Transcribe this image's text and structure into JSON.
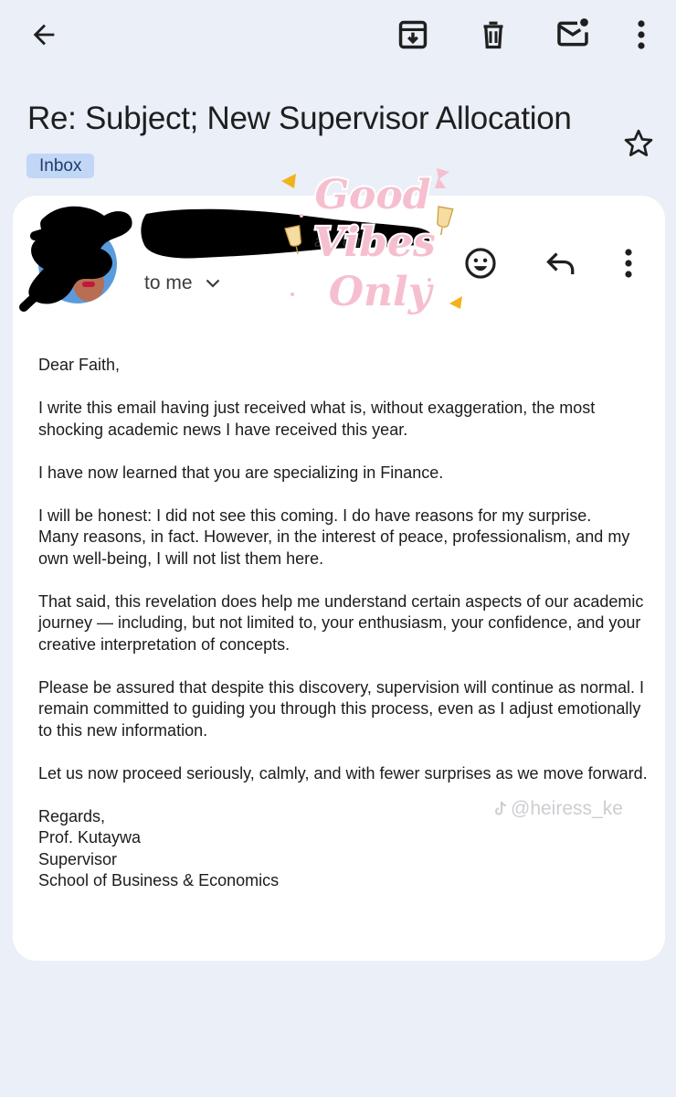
{
  "toolbar": {
    "icons": [
      "back-arrow-icon",
      "archive-icon",
      "trash-icon",
      "mark-unread-icon",
      "more-vert-icon"
    ]
  },
  "email": {
    "subject": "Re: Subject; New Supervisor Allocation",
    "label": "Inbox",
    "recipient": "to me",
    "sender_partial": "a: · em",
    "body": {
      "greeting": "Dear Faith,",
      "p1": "I write this email having just received what is, without exaggeration, the most shocking academic news I have received this year.",
      "p2": "I have now learned that you are specializing in Finance.",
      "p3_line1": "I will be honest: I did not see this coming. I do have reasons for my surprise.",
      "p3_line2": "Many reasons, in fact. However, in the interest of peace, professionalism, and my own well-being, I will not list them here.",
      "p4": "That said, this revelation does help me understand certain aspects of our academic journey — including, but not limited to, your enthusiasm, your confidence, and your creative interpretation of concepts.",
      "p5": "Please be assured that despite this discovery, supervision will continue as normal. I remain committed to guiding you through this process, even as I adjust emotionally to this new information.",
      "p6": "Let us now proceed seriously, calmly, and with fewer surprises as we move forward.",
      "signoff": "Regards,",
      "sig_name": "Prof. Kutaywa",
      "sig_title": "Supervisor",
      "sig_dept": "School of Business & Economics"
    }
  },
  "sticker": {
    "line1": "Good",
    "line2": "Vibes",
    "line3": "Only",
    "color": "#f6bfcf"
  },
  "watermark": {
    "handle": "@heiress_ke"
  },
  "colors": {
    "background": "#eaeff8",
    "card": "#ffffff",
    "chip": "#c2d7f5",
    "chip_text": "#1f3a6e"
  }
}
